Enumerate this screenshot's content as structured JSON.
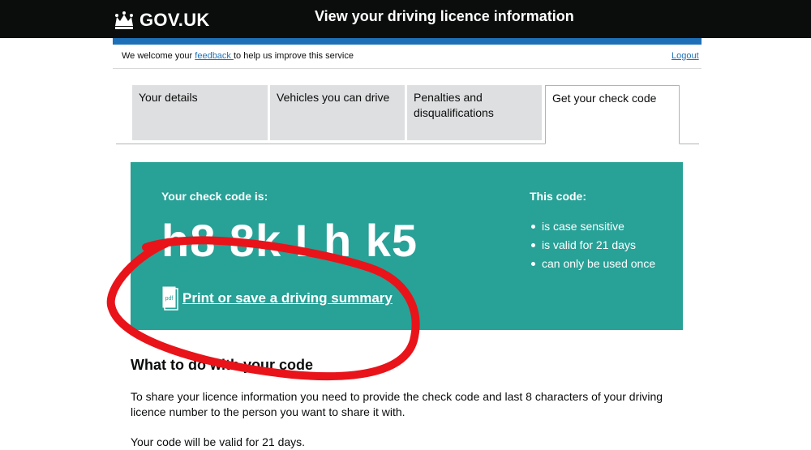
{
  "header": {
    "logo_text": "GOV.UK",
    "service_title": "View your driving licence information"
  },
  "feedback_bar": {
    "prefix": "We welcome your ",
    "link": "feedback ",
    "suffix": "to help us improve this service",
    "logout": "Logout"
  },
  "tabs": [
    {
      "label": "Your details",
      "active": false
    },
    {
      "label": "Vehicles you can drive",
      "active": false
    },
    {
      "label": "Penalties and disqualifications",
      "active": false
    },
    {
      "label": "Get your check code",
      "active": true
    }
  ],
  "check_panel": {
    "label": "Your check code is:",
    "code": "h8 8k Lh k5",
    "pdf_icon_text": "pdf",
    "print_link": "Print or save a driving summary",
    "this_code_heading": "This code:",
    "this_code_items": [
      "is case sensitive",
      "is valid for 21 days",
      "can only be used once"
    ],
    "background": "#28a197"
  },
  "content": {
    "heading": "What to do with your code",
    "para1": "To share your licence information you need to provide the check code and last 8 characters of your driving licence number to the person you want to share it with.",
    "para2": "Your code will be valid for 21 days."
  },
  "colors": {
    "header": "#0b0c0c",
    "brand_blue": "#1d70b8",
    "link": "#1d70b8",
    "annotation_red": "#e8141a"
  }
}
